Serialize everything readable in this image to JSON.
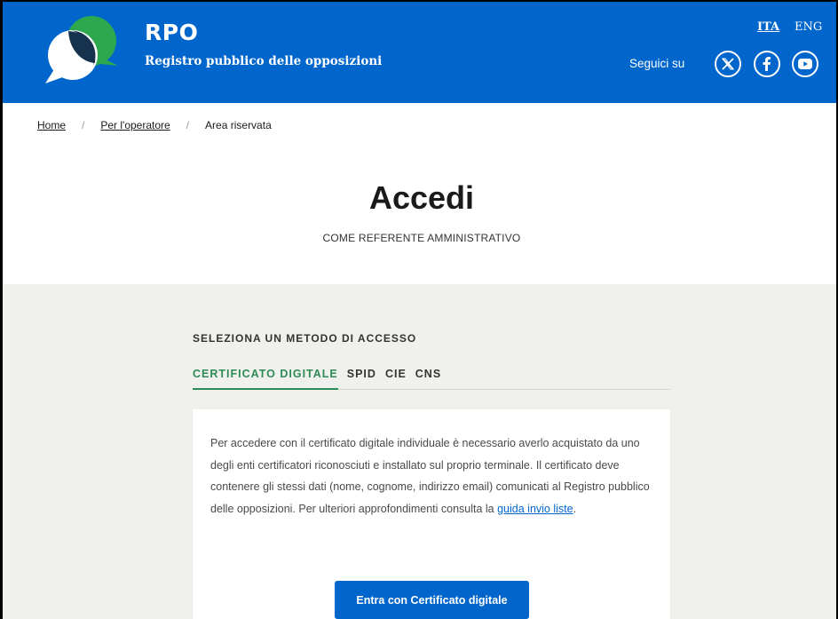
{
  "header": {
    "title": "RPO",
    "subtitle": "Registro pubblico delle opposizioni",
    "languages": {
      "ita": "ITA",
      "eng": "ENG"
    },
    "follow_label": "Seguici su",
    "social": [
      "x-icon",
      "facebook-icon",
      "youtube-icon"
    ],
    "colors": {
      "header_bg": "#0066cc",
      "logo_green": "#2ea84f",
      "logo_navy": "#17324d"
    }
  },
  "breadcrumb": {
    "items": [
      "Home",
      "Per l'operatore",
      "Area riservata"
    ],
    "separator": "/"
  },
  "page": {
    "title": "Accedi",
    "subtitle": "COME REFERENTE AMMINISTRATIVO"
  },
  "access": {
    "section_label": "SELEZIONA UN METODO DI ACCESSO",
    "tabs": [
      "CERTIFICATO DIGITALE",
      "SPID",
      "CIE",
      "CNS"
    ],
    "active_tab": "CERTIFICATO DIGITALE",
    "description_before_link": "Per accedere con il certificato digitale individuale è necessario averlo acquistato da uno degli enti certificatori riconosciuti e installato sul proprio terminale. Il certificato deve contenere gli stessi dati (nome, cognome, indirizzo email) comunicati al Registro pubblico delle opposizioni. Per ulteriori approfondimenti consulta la ",
    "link_text": "guida invio liste",
    "description_after_link": ".",
    "button_label": "Entra con Certificato digitale",
    "accent_color": "#2e8b57"
  }
}
